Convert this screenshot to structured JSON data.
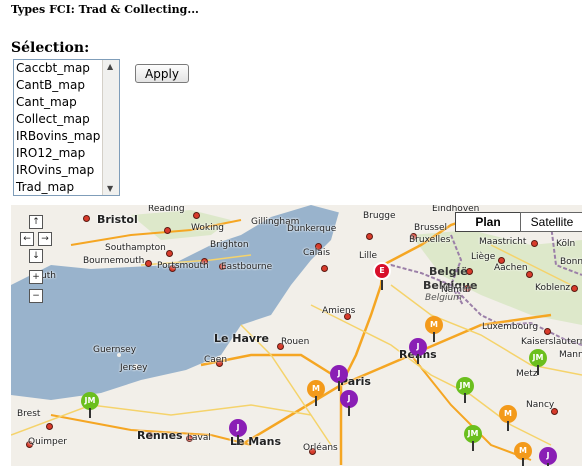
{
  "page": {
    "title": "Types FCI: Trad & Collecting...",
    "selection_label": "Sélection:",
    "apply_label": "Apply"
  },
  "listbox": {
    "options": [
      "Caccbt_map",
      "CantB_map",
      "Cant_map",
      "Collect_map",
      "IRBovins_map",
      "IRO12_map",
      "IROvins_map",
      "Trad_map"
    ]
  },
  "map": {
    "map_types": [
      "Plan",
      "Satellite"
    ],
    "selected_type": "Plan",
    "nav": {
      "up": "↑",
      "left": "←",
      "right": "→",
      "down": "↓",
      "zoom_in": "+",
      "zoom_out": "−"
    },
    "labels": {
      "reading": "Reading",
      "bristol": "Bristol",
      "woking": "Woking",
      "gillingham": "Gillingham",
      "southampton": "Southampton",
      "brighton": "Brighton",
      "bournemouth": "Bournemouth",
      "portsmouth": "Portsmouth",
      "eastbourne": "Eastbourne",
      "plymouth": "uth",
      "dunkerque": "Dunkerque",
      "calais": "Calais",
      "brugge": "Brugge",
      "brussel": "Brussel",
      "bruxelles": "Bruxelles",
      "lille": "Lille",
      "belgique_fr": "België",
      "belgique": "Belgique",
      "belgium": "Belgium",
      "eindhoven": "Eindhoven",
      "maastricht": "Maastricht",
      "koln": "Köln",
      "bonn": "Bonn",
      "liege": "Liège",
      "aachen": "Aachen",
      "namur": "Namur",
      "koblenz": "Koblenz",
      "amiens": "Amiens",
      "le_havre": "Le Havre",
      "caen": "Caen",
      "rouen": "Rouen",
      "reims": "Reims",
      "paris": "Paris",
      "luxembourg": "Luxembourg",
      "kaiserslautern": "Kaiserslautern",
      "mannheim": "Mannh",
      "metz": "Metz",
      "nancy": "Nancy",
      "guernsey": "Guernsey",
      "jersey": "Jersey",
      "brest": "Brest",
      "quimper": "Quimper",
      "rennes": "Rennes",
      "laval": "Laval",
      "le_mans": "Le Mans",
      "orleans": "Orléans"
    },
    "pins": [
      {
        "label": "E",
        "color": "#d8102b"
      },
      {
        "label": "M",
        "color": "#f39a1b"
      },
      {
        "label": "J",
        "color": "#8a1eb5"
      },
      {
        "label": "JM",
        "color": "#6bbf1e"
      }
    ]
  }
}
